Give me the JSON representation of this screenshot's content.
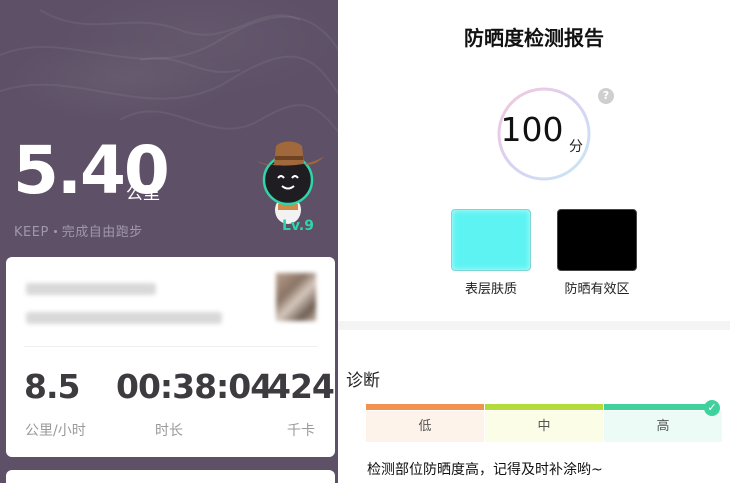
{
  "left_panel": {
    "distance": "5.40",
    "distance_unit": "公里",
    "brand": "KEEP",
    "activity": "完成自由跑步",
    "level": "Lv.9",
    "stats": [
      {
        "value": "8.5",
        "label": "公里/小时"
      },
      {
        "value": "00:38:04",
        "label": "时长"
      },
      {
        "value": "424",
        "label": "千卡"
      }
    ],
    "colors": {
      "background": "#5e5167",
      "level": "#2fd4a8"
    }
  },
  "right_panel": {
    "title": "防晒度检测报告",
    "score": "100",
    "score_unit": "分",
    "help": "?",
    "images": [
      {
        "label": "表层肤质",
        "color": "#5ef3f3"
      },
      {
        "label": "防晒有效区",
        "color": "#000000"
      }
    ],
    "diagnosis": {
      "title": "诊断",
      "levels": [
        "低",
        "中",
        "高"
      ],
      "selected": "高",
      "text": "检测部位防晒度高，记得及时补涂哟~"
    },
    "colors": {
      "low": "#f0934e",
      "mid": "#b3db3a",
      "high": "#3fd29d"
    }
  }
}
